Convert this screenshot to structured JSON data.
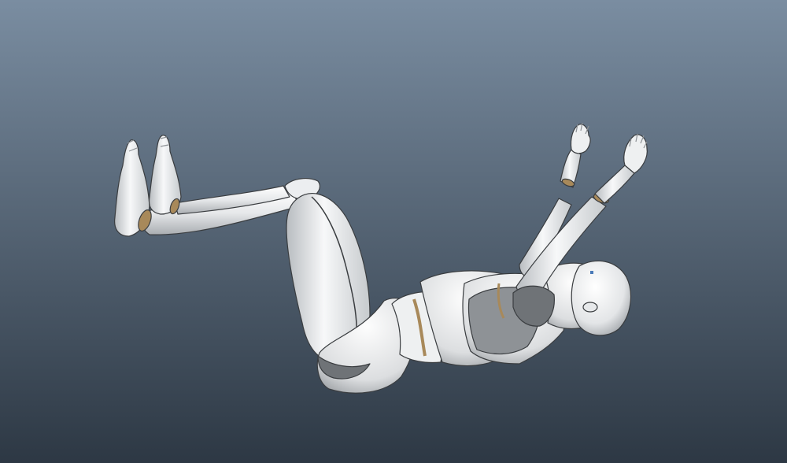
{
  "scene": {
    "subject": "mannequin-figure",
    "background": {
      "top_color": "#7a8da1",
      "bottom_color": "#2d3844"
    },
    "figure_colors": {
      "body_light": "#f4f5f6",
      "body_mid": "#d8dadc",
      "body_shadow": "#8e9296",
      "interior_shadow": "#6f7377",
      "outline": "#3a3d40",
      "joint_ring": "#a8895a"
    }
  }
}
